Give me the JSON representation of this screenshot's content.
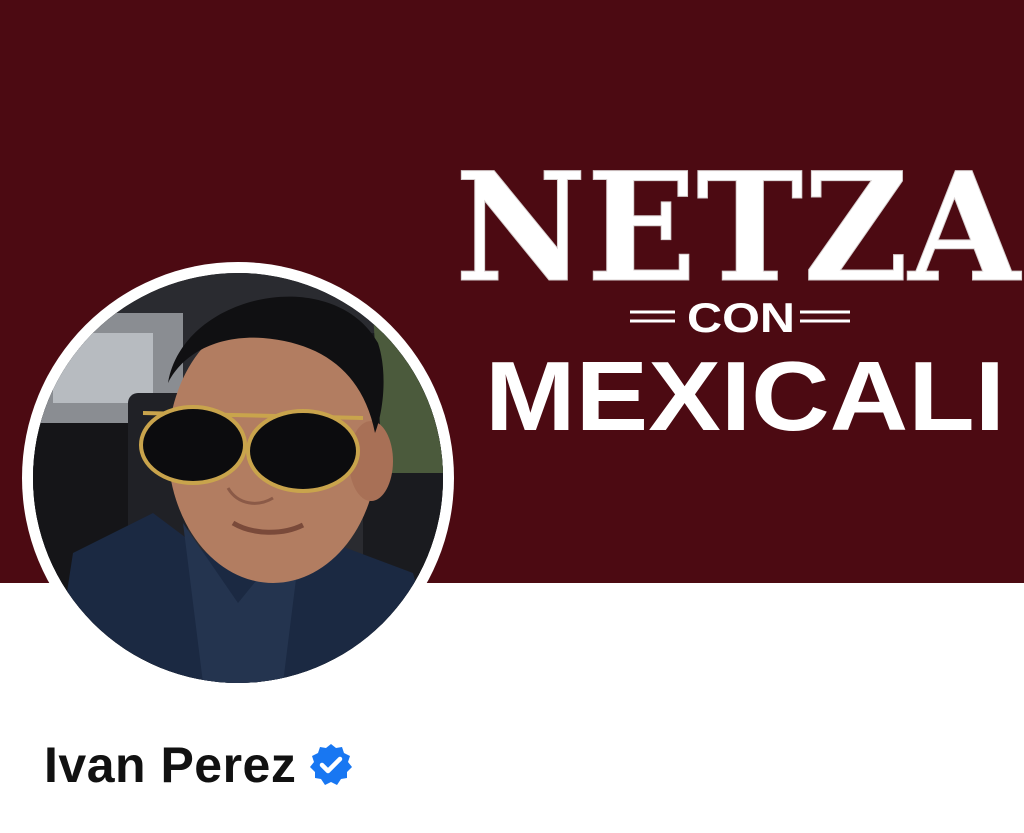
{
  "cover": {
    "line1": "NETZA",
    "line2": "CON",
    "line3": "MEXICALI",
    "background_color": "#4c0a12",
    "text_color": "#ffffff"
  },
  "profile": {
    "name": "Ivan Perez",
    "verified": true,
    "verified_icon": "verified-badge-icon",
    "badge_color": "#1877f2"
  }
}
